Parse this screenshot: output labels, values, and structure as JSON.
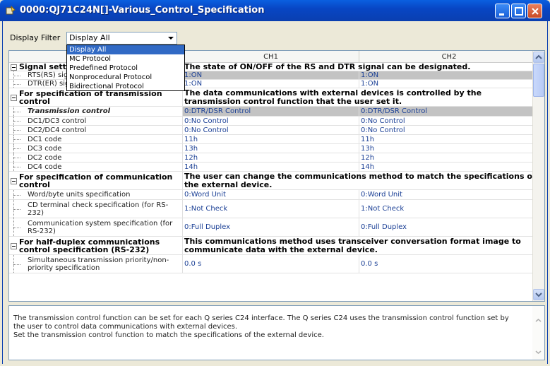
{
  "window": {
    "title": "0000:QJ71C24N[]-Various_Control_Specification"
  },
  "filter": {
    "label": "Display Filter",
    "value": "Display All",
    "options": [
      "Display All",
      "MC Protocol",
      "Predefined Protocol",
      "Nonprocedural Protocol",
      "Bidirectional Protocol"
    ]
  },
  "grid": {
    "columns": [
      "",
      "CH1",
      "CH2"
    ],
    "rows": [
      {
        "type": "cat",
        "label": "Signal setting",
        "desc": "The state of ON/OFF of the RS and DTR signal can be designated."
      },
      {
        "type": "item",
        "label": "RTS(RS) signal status specification",
        "ch1": "1:ON",
        "ch2": "1:ON",
        "selected": true
      },
      {
        "type": "item",
        "label": "DTR(ER) signal status specification",
        "ch1": "1:ON",
        "ch2": "1:ON",
        "selected": false
      },
      {
        "type": "cat",
        "label": "For specification of transmission control",
        "desc": "The data communications with external devices is controlled by the transmission control function that the user set it."
      },
      {
        "type": "item",
        "label": "Transmission control",
        "ch1": "0:DTR/DSR Control",
        "ch2": "0:DTR/DSR Control",
        "selected": true,
        "bold": true
      },
      {
        "type": "item",
        "label": "DC1/DC3 control",
        "ch1": "0:No Control",
        "ch2": "0:No Control"
      },
      {
        "type": "item",
        "label": "DC2/DC4 control",
        "ch1": "0:No Control",
        "ch2": "0:No Control"
      },
      {
        "type": "item",
        "label": "DC1 code",
        "ch1": "11h",
        "ch2": "11h"
      },
      {
        "type": "item",
        "label": "DC3 code",
        "ch1": "13h",
        "ch2": "13h"
      },
      {
        "type": "item",
        "label": "DC2 code",
        "ch1": "12h",
        "ch2": "12h"
      },
      {
        "type": "item",
        "label": "DC4 code",
        "ch1": "14h",
        "ch2": "14h"
      },
      {
        "type": "cat",
        "label": "For specification of communication control",
        "desc": "The user can change the communications method to match the specifications of the external device."
      },
      {
        "type": "item",
        "label": "Word/byte units specification",
        "ch1": "0:Word Unit",
        "ch2": "0:Word Unit"
      },
      {
        "type": "item",
        "label": "CD terminal check specification (for RS-232)",
        "ch1": "1:Not Check",
        "ch2": "1:Not Check"
      },
      {
        "type": "item",
        "label": "Communication system specification (for RS-232)",
        "ch1": "0:Full Duplex",
        "ch2": "0:Full Duplex"
      },
      {
        "type": "cat",
        "label": "For half-duplex communications control specification (RS-232)",
        "desc": "This communications method uses transceiver conversation format image to communicate data with the external device."
      },
      {
        "type": "item",
        "label": "Simultaneous transmission priority/non-priority specification",
        "ch1": "0.0 s",
        "ch2": "0.0 s"
      }
    ]
  },
  "description": "The transmission control function can be set for each Q series C24 interface. The Q series C24 uses the transmission control function set by the user to control data communications with external devices.\nSet the transmission control function to match the specifications of the external device.",
  "colors": {
    "titlebar": "#0a5fe0",
    "value_text": "#1a3f95",
    "selection": "#316ac5",
    "selected_row": "#c3c3c3"
  }
}
